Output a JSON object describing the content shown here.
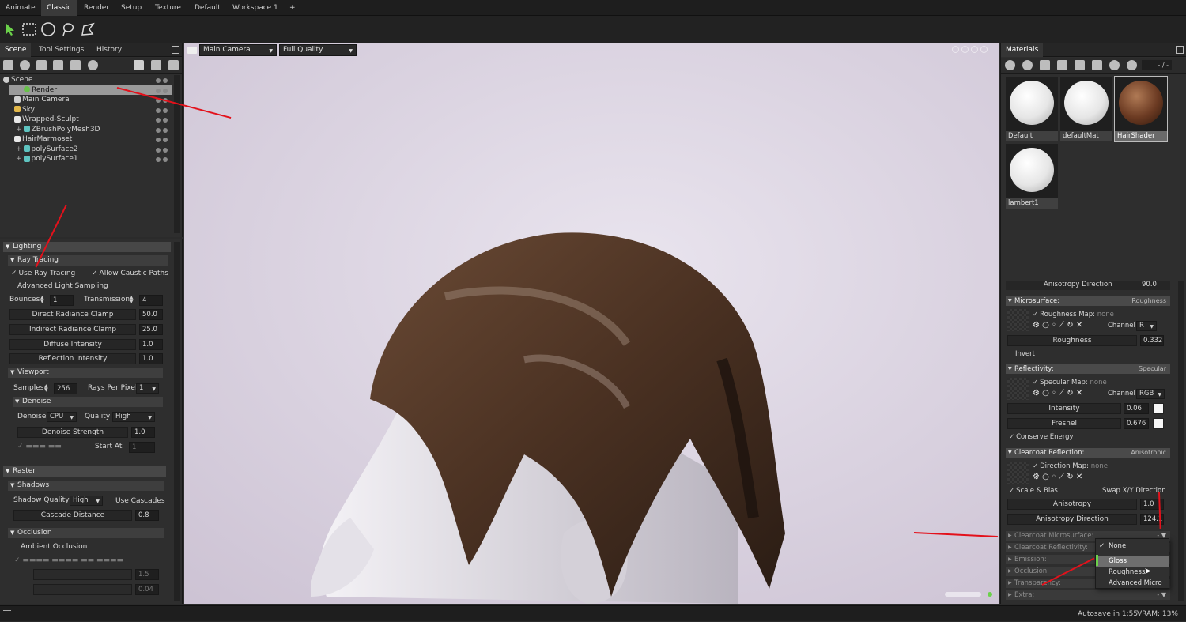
{
  "menubar": {
    "items": [
      "Animate",
      "Classic",
      "Render",
      "Setup",
      "Texture",
      "Default",
      "Workspace 1",
      "+"
    ],
    "active": "Classic"
  },
  "toolbar": {
    "tools": [
      "select-arrow-icon",
      "rect-select-icon",
      "ellipse-select-icon",
      "lasso-select-icon",
      "polygon-select-icon"
    ]
  },
  "scene_panel": {
    "tabs": [
      "Scene",
      "Tool Settings",
      "History"
    ],
    "tree": [
      {
        "label": "Scene",
        "indent": 0
      },
      {
        "label": "Render",
        "indent": 1,
        "selected": true
      },
      {
        "label": "Main Camera",
        "indent": 1
      },
      {
        "label": "Sky",
        "indent": 1
      },
      {
        "label": "Wrapped-Sculpt",
        "indent": 1
      },
      {
        "label": "ZBrushPolyMesh3D",
        "indent": 2
      },
      {
        "label": "HairMarmoset",
        "indent": 1
      },
      {
        "label": "polySurface2",
        "indent": 2
      },
      {
        "label": "polySurface1",
        "indent": 2
      }
    ]
  },
  "lighting": {
    "title": "Lighting",
    "ray_tracing": "Ray Tracing",
    "use_ray_tracing": "Use Ray Tracing",
    "allow_caustic_paths": "Allow Caustic Paths",
    "advanced_light_sampling": "Advanced Light Sampling",
    "bounces_label": "Bounces",
    "bounces": "1",
    "transmission_label": "Transmission",
    "transmission": "4",
    "direct_radiance_clamp": "Direct Radiance Clamp",
    "direct_radiance_clamp_val": "50.0",
    "indirect_radiance_clamp": "Indirect Radiance Clamp",
    "indirect_radiance_clamp_val": "25.0",
    "diffuse_intensity": "Diffuse Intensity",
    "diffuse_intensity_val": "1.0",
    "reflection_intensity": "Reflection Intensity",
    "reflection_intensity_val": "1.0",
    "viewport": "Viewport",
    "samples_label": "Samples",
    "samples": "256",
    "rays_per_pixel_label": "Rays Per Pixel",
    "rays_per_pixel": "1",
    "denoise_sec": "Denoise",
    "denoise_label": "Denoise",
    "denoise": "CPU",
    "quality_label": "Quality",
    "quality": "High",
    "denoise_strength": "Denoise Strength",
    "denoise_strength_val": "1.0",
    "start_at_label": "Start At",
    "start_at": "1"
  },
  "raster": {
    "title": "Raster",
    "shadows": "Shadows",
    "shadow_quality_label": "Shadow Quality",
    "shadow_quality": "High",
    "use_cascades": "Use Cascades",
    "cascade_distance": "Cascade Distance",
    "cascade_distance_val": "0.8",
    "occlusion": "Occlusion",
    "ambient_occlusion": "Ambient Occlusion",
    "ao_val1": "1.5",
    "ao_val2": "0.04"
  },
  "viewport": {
    "camera": "Main Camera",
    "quality": "Full Quality"
  },
  "materials": {
    "title": "Materials",
    "counter": "- / -",
    "thumbs": [
      {
        "label": "Default",
        "color": "#f2f2f2"
      },
      {
        "label": "defaultMat",
        "color": "#f2f2f2"
      },
      {
        "label": "HairShader",
        "color": "#6b3a22",
        "selected": true
      },
      {
        "label": "lambert1",
        "color": "#f2f2f2"
      }
    ],
    "aniso_dir_top": "Anisotropy Direction",
    "aniso_dir_top_val": "90.0",
    "microsurface": "Microsurface:",
    "microsurface_mode": "Roughness",
    "roughness_map": "Roughness Map:",
    "roughness_map_val": "none",
    "channel_label": "Channel",
    "roughness_channel": "R",
    "roughness": "Roughness",
    "roughness_val": "0.332",
    "invert": "Invert",
    "reflectivity": "Reflectivity:",
    "reflectivity_mode": "Specular",
    "specular_map": "Specular Map:",
    "specular_map_val": "none",
    "specular_channel": "RGB",
    "intensity": "Intensity",
    "intensity_val": "0.06",
    "fresnel": "Fresnel",
    "fresnel_val": "0.676",
    "conserve_energy": "Conserve Energy",
    "clearcoat_reflection": "Clearcoat Reflection:",
    "clearcoat_reflection_mode": "Anisotropic",
    "direction_map": "Direction Map:",
    "direction_map_val": "none",
    "scale_bias": "Scale & Bias",
    "swap_xy": "Swap X/Y Direction",
    "anisotropy": "Anisotropy",
    "anisotropy_val": "1.0",
    "anisotropy_direction": "Anisotropy Direction",
    "anisotropy_direction_val": "124.1",
    "clearcoat_microsurface": "Clearcoat Microsurface:",
    "clearcoat_reflectivity": "Clearcoat Reflectivity:",
    "emission": "Emission:",
    "occlusion": "Occlusion:",
    "transparency": "Transparency:",
    "extra": "Extra:"
  },
  "popup": {
    "options": [
      "None",
      "Gloss",
      "Roughness",
      "Advanced Micro"
    ],
    "checked": "None",
    "hovered": "Gloss"
  },
  "statusbar": {
    "autosave": "Autosave in 1:55",
    "vram": "VRAM: 13%"
  },
  "colors": {
    "accent_red": "#e3111b",
    "highlight": "#6e6e6e"
  }
}
